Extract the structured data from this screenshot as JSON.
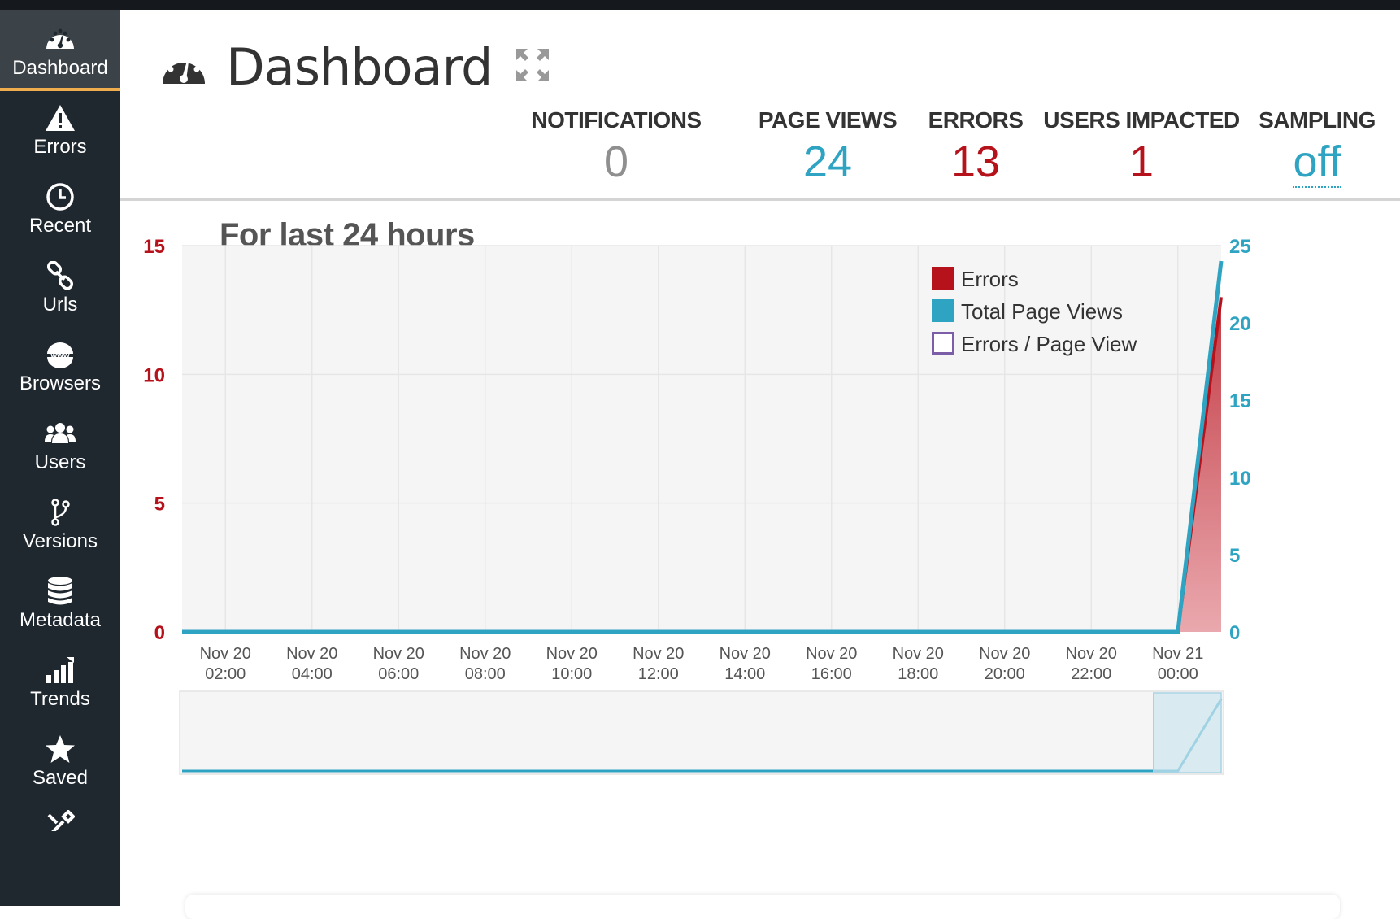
{
  "sidebar": {
    "items": [
      {
        "label": "Dashboard",
        "icon": "dashboard-icon"
      },
      {
        "label": "Errors",
        "icon": "warning-icon"
      },
      {
        "label": "Recent",
        "icon": "clock-icon"
      },
      {
        "label": "Urls",
        "icon": "link-icon"
      },
      {
        "label": "Browsers",
        "icon": "www-icon"
      },
      {
        "label": "Users",
        "icon": "users-icon"
      },
      {
        "label": "Versions",
        "icon": "branch-icon"
      },
      {
        "label": "Metadata",
        "icon": "database-icon"
      },
      {
        "label": "Trends",
        "icon": "bar-chart-icon"
      },
      {
        "label": "Saved",
        "icon": "star-icon"
      }
    ],
    "active": "Dashboard"
  },
  "header": {
    "title": "Dashboard",
    "stats": [
      {
        "label": "NOTIFICATIONS",
        "value": "0",
        "color": "#8f8f8f"
      },
      {
        "label": "PAGE VIEWS",
        "value": "24",
        "color": "#2fa4c2"
      },
      {
        "label": "ERRORS",
        "value": "13",
        "color": "#b5121b"
      },
      {
        "label": "USERS IMPACTED",
        "value": "1",
        "color": "#b5121b"
      },
      {
        "label": "SAMPLING",
        "value": "off",
        "color": "#2fa4c2"
      }
    ]
  },
  "section": {
    "title": "For last 24 hours"
  },
  "chart_data": {
    "type": "area",
    "title": "",
    "x": [
      "Nov 20 02:00",
      "Nov 20 04:00",
      "Nov 20 06:00",
      "Nov 20 08:00",
      "Nov 20 10:00",
      "Nov 20 12:00",
      "Nov 20 14:00",
      "Nov 20 16:00",
      "Nov 20 18:00",
      "Nov 20 20:00",
      "Nov 20 22:00",
      "Nov 21 00:00"
    ],
    "tick_labels": [
      [
        "Nov 20",
        "02:00"
      ],
      [
        "Nov 20",
        "04:00"
      ],
      [
        "Nov 20",
        "06:00"
      ],
      [
        "Nov 20",
        "08:00"
      ],
      [
        "Nov 20",
        "10:00"
      ],
      [
        "Nov 20",
        "12:00"
      ],
      [
        "Nov 20",
        "14:00"
      ],
      [
        "Nov 20",
        "16:00"
      ],
      [
        "Nov 20",
        "18:00"
      ],
      [
        "Nov 20",
        "20:00"
      ],
      [
        "Nov 20",
        "22:00"
      ],
      [
        "Nov 21",
        "00:00"
      ]
    ],
    "x_range": [
      "Nov 20 01:00",
      "Nov 21 01:00"
    ],
    "y_left": {
      "ticks": [
        0,
        5,
        10,
        15
      ],
      "range": [
        0,
        15
      ],
      "color": "#b5121b"
    },
    "y_right": {
      "ticks": [
        0,
        5,
        10,
        15,
        20,
        25
      ],
      "range": [
        0,
        25
      ],
      "color": "#2fa4c2"
    },
    "series": [
      {
        "name": "Errors",
        "axis": "left",
        "color": "#b5121b",
        "points": [
          [
            "Nov 20 01:00",
            0
          ],
          [
            "Nov 21 00:00",
            0
          ],
          [
            "Nov 21 01:00",
            13
          ]
        ]
      },
      {
        "name": "Total Page Views",
        "axis": "right",
        "color": "#2fa4c2",
        "points": [
          [
            "Nov 20 01:00",
            0
          ],
          [
            "Nov 21 00:00",
            0
          ],
          [
            "Nov 21 01:00",
            24
          ]
        ]
      },
      {
        "name": "Errors / Page View",
        "axis": "left",
        "color": "#7b5ea7",
        "points": []
      }
    ],
    "legend_position": "top-right",
    "grid": true,
    "navigator": {
      "selected_range": [
        "Nov 21 00:00",
        "Nov 21 01:00"
      ]
    }
  }
}
